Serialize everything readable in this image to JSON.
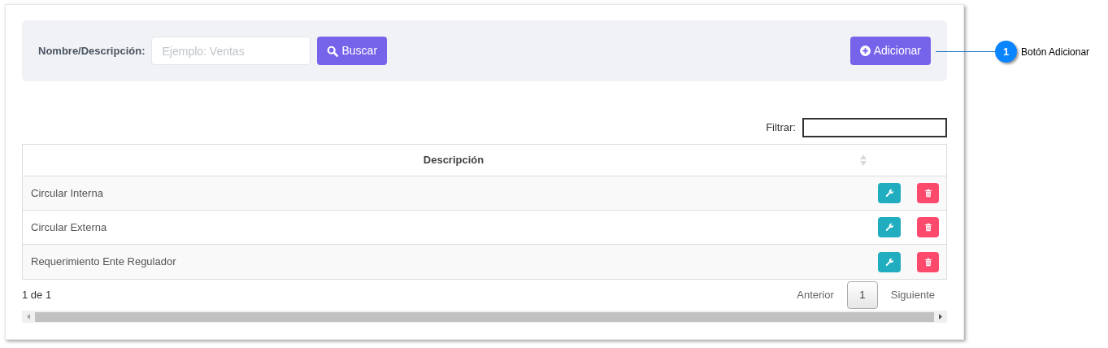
{
  "search_panel": {
    "label": "Nombre/Descripción:",
    "placeholder": "Ejemplo: Ventas",
    "search_button": "Buscar",
    "add_button": "Adicionar"
  },
  "filter": {
    "label": "Filtrar:"
  },
  "table": {
    "columns": [
      "Descripción"
    ],
    "rows": [
      {
        "description": "Circular Interna"
      },
      {
        "description": "Circular Externa"
      },
      {
        "description": "Requerimiento Ente Regulador"
      }
    ]
  },
  "pagination": {
    "summary": "1 de 1",
    "previous": "Anterior",
    "pages": [
      {
        "label": "1",
        "selected": true
      }
    ],
    "next": "Siguiente"
  },
  "callout": {
    "number": "1",
    "text": "Botón Adicionar"
  }
}
